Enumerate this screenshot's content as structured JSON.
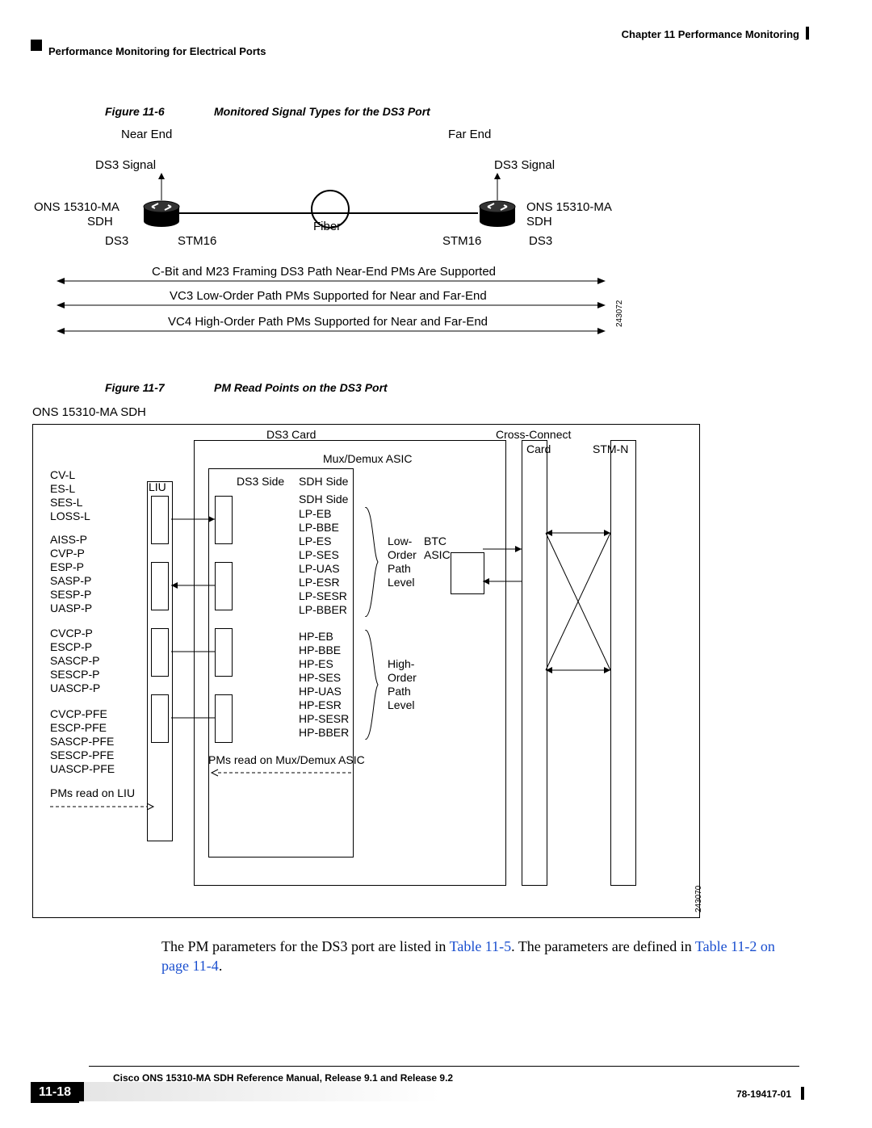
{
  "header": {
    "chapter": "Chapter 11      Performance Monitoring",
    "section": "Performance Monitoring for Electrical Ports"
  },
  "figure1": {
    "label_num": "Figure 11-6",
    "label_title": "Monitored Signal Types for the DS3 Port",
    "near_end": "Near End",
    "far_end": "Far End",
    "ds3_signal_l": "DS3 Signal",
    "ds3_signal_r": "DS3 Signal",
    "ons_l": "ONS 15310-MA",
    "sdh_l": "SDH",
    "ons_r": "ONS 15310-MA",
    "sdh_r": "SDH",
    "fiber": "Fiber",
    "ds3_l": "DS3",
    "stm16_l": "STM16",
    "stm16_r": "STM16",
    "ds3_r": "DS3",
    "note1": "C-Bit and M23 Framing DS3 Path Near-End PMs Are Supported",
    "note2": "VC3 Low-Order Path PMs Supported for Near and Far-End",
    "note3": "VC4 High-Order Path PMs Supported for Near and Far-End",
    "idnum": "243072"
  },
  "figure2": {
    "label_num": "Figure 11-7",
    "label_title": "PM Read Points on the DS3 Port",
    "dev": "ONS 15310-MA SDH",
    "ds3_card": "DS3 Card",
    "cross_connect": "Cross-Connect",
    "card": "Card",
    "stm_n": "STM-N",
    "mux_demux": "Mux/Demux ASIC",
    "ds3_side": "DS3 Side",
    "sdh_side": "SDH Side",
    "sdh_side2": "SDH Side",
    "liustack": [
      "CV-L",
      "ES-L",
      "SES-L",
      "LOSS-L"
    ],
    "aissstack": [
      "AISS-P",
      "CVP-P",
      "ESP-P",
      "SASP-P",
      "SESP-P",
      "UASP-P"
    ],
    "cvcpstack": [
      "CVCP-P",
      "ESCP-P",
      "SASCP-P",
      "SESCP-P",
      "UASCP-P"
    ],
    "cvcpfestack": [
      "CVCP-PFE",
      "ESCP-PFE",
      "SASCP-PFE",
      "SESCP-PFE",
      "UASCP-PFE"
    ],
    "pm_liu": "PMs read on LIU",
    "liu": "LIU",
    "lp": [
      "LP-EB",
      "LP-BBE",
      "LP-ES",
      "LP-SES",
      "LP-UAS",
      "LP-ESR",
      "LP-SESR",
      "LP-BBER"
    ],
    "hp": [
      "HP-EB",
      "HP-BBE",
      "HP-ES",
      "HP-SES",
      "HP-UAS",
      "HP-ESR",
      "HP-SESR",
      "HP-BBER"
    ],
    "low_order": "Low-",
    "low_order2": "Order",
    "low_order3": "Path",
    "low_order4": "Level",
    "high_order": "High-",
    "high_order2": "Order",
    "high_order3": "Path",
    "high_order4": "Level",
    "btc": "BTC",
    "asic": "ASIC",
    "pm_mux": "PMs read on Mux/Demux ASIC",
    "idnum": "243070"
  },
  "paragraph": {
    "t1": "The PM parameters for the DS3 port are listed in ",
    "link1": "Table 11-5",
    "t2": ". The parameters are defined in ",
    "link2": "Table 11-2 on page 11-4",
    "t3": "."
  },
  "footer": {
    "title": "Cisco ONS 15310-MA SDH Reference Manual, Release 9.1 and Release 9.2",
    "page": "11-18",
    "docnum": "78-19417-01"
  }
}
